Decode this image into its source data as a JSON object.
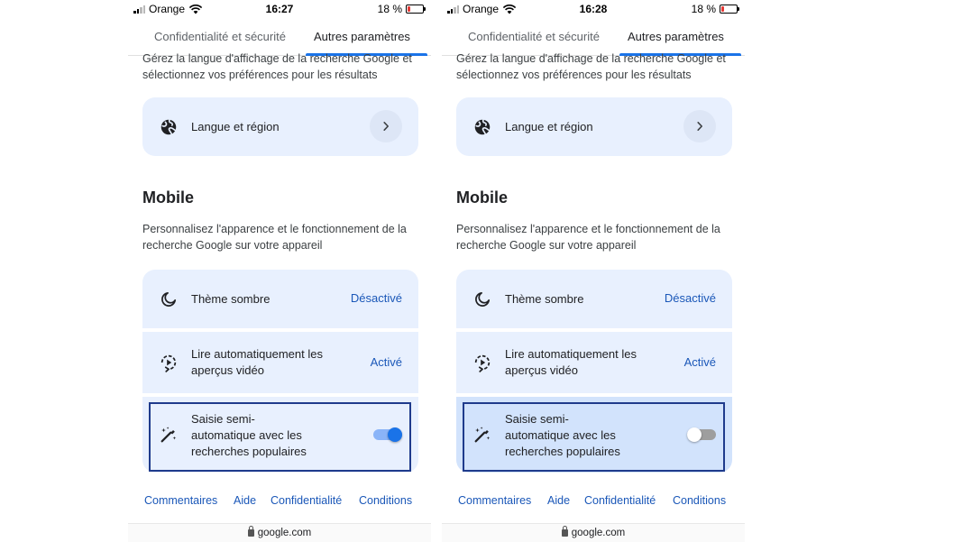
{
  "screens": [
    {
      "status": {
        "carrier": "Orange",
        "time": "16:27",
        "battery": "18 %",
        "battery_level": 0.18
      },
      "tabs": [
        {
          "label": "Confidentialité et sécurité"
        },
        {
          "label": "Autres paramètres"
        }
      ],
      "language_section": {
        "description": "Gérez la langue d'affichage de la recherche Google et sélectionnez vos préférences pour les résultats",
        "card_label": "Langue et région"
      },
      "mobile_section": {
        "title": "Mobile",
        "description": "Personnalisez l'apparence et le fonctionnement de la recherche Google sur votre appareil",
        "dark_theme": {
          "label": "Thème sombre",
          "value": "Désactivé"
        },
        "autoplay": {
          "label": "Lire automatiquement les aperçus vidéo",
          "value": "Activé"
        },
        "autocomplete": {
          "label": "Saisie semi-automatique avec les recherches populaires",
          "enabled": true
        }
      },
      "footer": {
        "feedback": "Commentaires",
        "help": "Aide",
        "privacy": "Confidentialité",
        "terms": "Conditions"
      },
      "url": "google.com"
    },
    {
      "status": {
        "carrier": "Orange",
        "time": "16:28",
        "battery": "18 %",
        "battery_level": 0.18
      },
      "tabs": [
        {
          "label": "Confidentialité et sécurité"
        },
        {
          "label": "Autres paramètres"
        }
      ],
      "language_section": {
        "description": "Gérez la langue d'affichage de la recherche Google et sélectionnez vos préférences pour les résultats",
        "card_label": "Langue et région"
      },
      "mobile_section": {
        "title": "Mobile",
        "description": "Personnalisez l'apparence et le fonctionnement de la recherche Google sur votre appareil",
        "dark_theme": {
          "label": "Thème sombre",
          "value": "Désactivé"
        },
        "autoplay": {
          "label": "Lire automatiquement les aperçus vidéo",
          "value": "Activé"
        },
        "autocomplete": {
          "label": "Saisie semi-automatique avec les recherches populaires",
          "enabled": false
        }
      },
      "footer": {
        "feedback": "Commentaires",
        "help": "Aide",
        "privacy": "Confidentialité",
        "terms": "Conditions"
      },
      "url": "google.com"
    }
  ],
  "colors": {
    "accent": "#1a73e8",
    "link": "#1a57b8",
    "card_background": "#e8f0fe",
    "selected_card_background": "#d2e3fc",
    "selection_border": "#1f3b8c"
  },
  "icons": {
    "language": "globe-icon",
    "navigate": "chevron-right-icon",
    "dark_theme": "moon-icon",
    "autoplay": "video-play-icon",
    "autocomplete": "magic-pen-icon"
  }
}
